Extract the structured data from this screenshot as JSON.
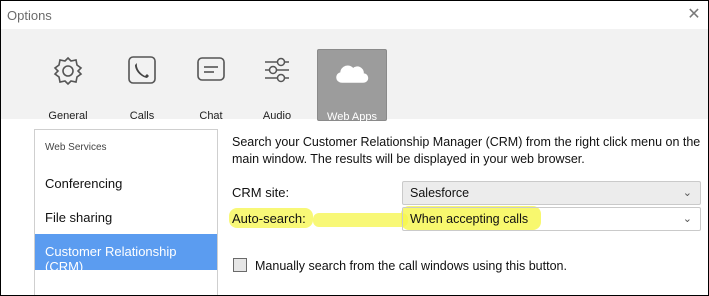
{
  "window": {
    "title": "Options",
    "close_glyph": "✕"
  },
  "toolbar": {
    "items": [
      {
        "label": "General",
        "icon": "gear-icon"
      },
      {
        "label": "Calls",
        "icon": "phone-icon"
      },
      {
        "label": "Chat",
        "icon": "chat-icon"
      },
      {
        "label": "Audio",
        "icon": "sliders-icon"
      },
      {
        "label": "Web Apps",
        "icon": "cloud-icon",
        "active": true
      }
    ]
  },
  "sidebar": {
    "items": [
      {
        "label": "Web Services"
      },
      {
        "label": "Conferencing"
      },
      {
        "label": "File sharing"
      },
      {
        "label": "Customer Relationship (CRM)",
        "active": true
      }
    ]
  },
  "main": {
    "description": "Search your Customer Relationship Manager (CRM) from the right click menu on the main window. The results will be displayed in your web browser.",
    "crm_site": {
      "label": "CRM site:",
      "value": "Salesforce"
    },
    "auto_search": {
      "label": "Auto-search:",
      "value": "When accepting calls"
    },
    "manual_text": "Manually search from the call windows using this button."
  },
  "colors": {
    "accent": "#5b9cf0",
    "highlight": "#f6f64a",
    "active_tool": "#9c9c9c"
  }
}
